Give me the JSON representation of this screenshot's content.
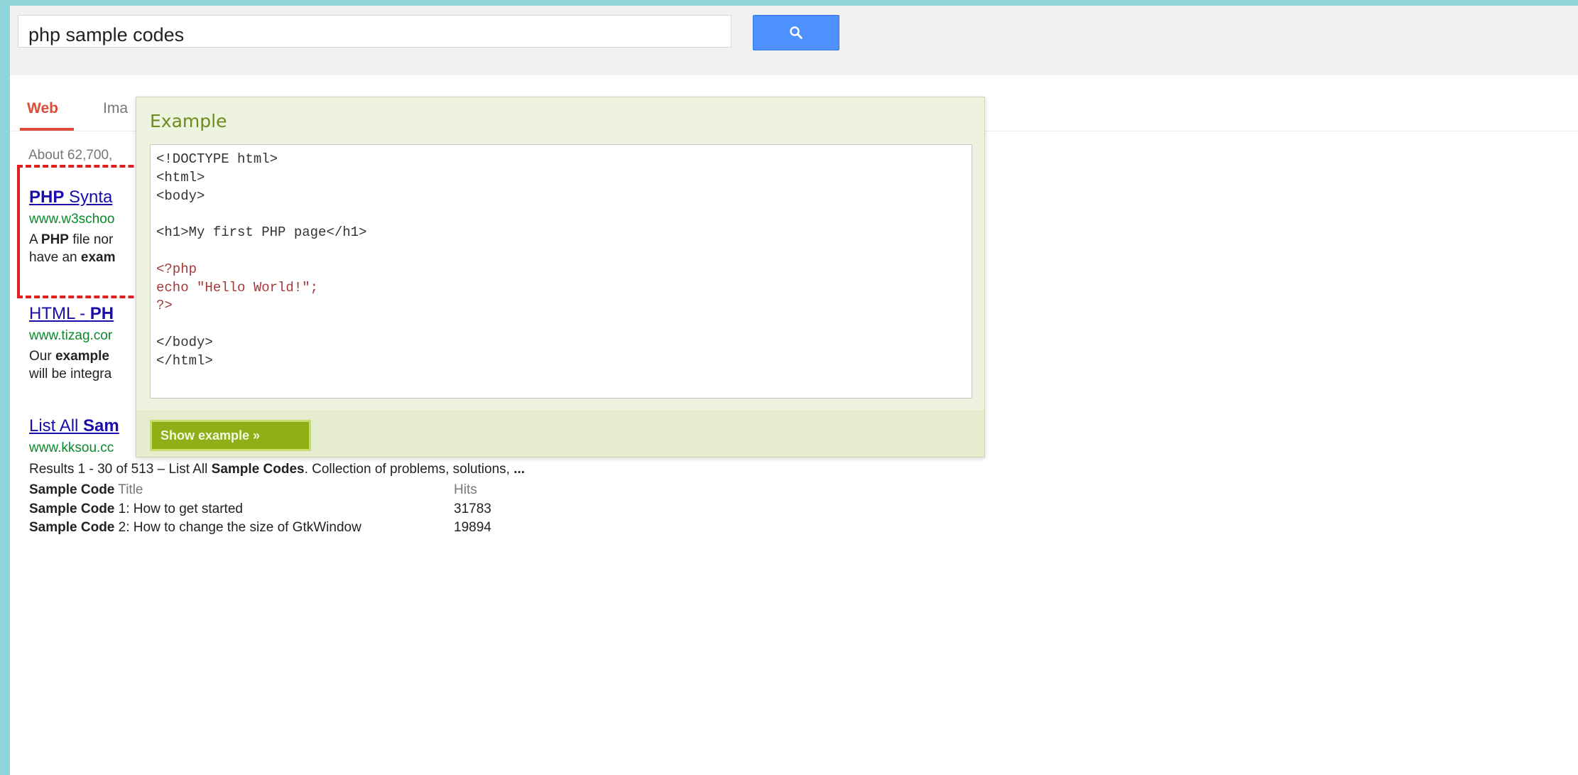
{
  "search": {
    "query": "php sample codes"
  },
  "tabs": [
    {
      "label": "Web"
    },
    {
      "label": "Ima"
    }
  ],
  "result_count": "About 62,700,",
  "results": [
    {
      "title_bold": "PHP",
      "title_rest": " Synta",
      "url": "www.w3schoo",
      "snippet_line1": {
        "pre": "A ",
        "bold": "PHP",
        "post": " file nor"
      },
      "snippet_line2": {
        "pre": "have an ",
        "bold": "exam",
        "post": ""
      }
    },
    {
      "title_pre": "HTML - ",
      "title_bold": "PH",
      "url": "www.tizag.cor",
      "snippet_line1": {
        "pre": "Our ",
        "bold": "example",
        "post": ""
      },
      "snippet_line2": {
        "pre": "will be integra",
        "bold": "",
        "post": ""
      }
    },
    {
      "title_pre": "List All ",
      "title_bold": "Sam",
      "url": "www.kksou.cc",
      "snippet": {
        "pre": "Results 1 - 30 of 513 – List All ",
        "bold": "Sample Codes",
        "post": ". Collection of problems, solutions, ",
        "bold2": "..."
      },
      "table": [
        {
          "bold": "Sample Code",
          "text": " Title",
          "hits": "Hits"
        },
        {
          "bold": "Sample Code",
          "text": " 1: How to get started",
          "hits": "31783"
        },
        {
          "bold": "Sample Code",
          "text": " 2: How to change the size of GtkWindow",
          "hits": "19894"
        }
      ]
    }
  ],
  "popup": {
    "title": "Example",
    "code_lines": [
      "<!DOCTYPE html>",
      "<html>",
      "<body>",
      "",
      "<h1>My first PHP page</h1>",
      "",
      "<?php",
      "echo \"Hello World!\";",
      "?>",
      "",
      "</body>",
      "</html>"
    ],
    "button_label": "Show example »"
  },
  "colors": {
    "search_button": "#4d90fe",
    "web_tab": "#dd4b39",
    "link": "#1a0dab",
    "url": "#0a8a2a",
    "highlight_border": "#e02020",
    "popup_title": "#6f8a1d",
    "show_button": "#8fae18"
  },
  "icons": {
    "search_button": "search-icon"
  }
}
